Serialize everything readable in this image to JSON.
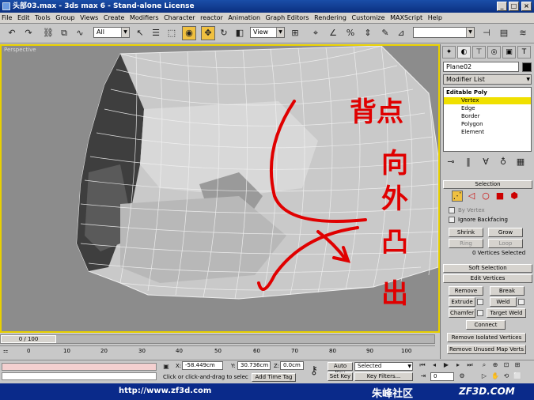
{
  "window": {
    "title": "头部03.max - 3ds max 6 - Stand-alone License"
  },
  "menu": [
    "File",
    "Edit",
    "Tools",
    "Group",
    "Views",
    "Create",
    "Modifiers",
    "Character",
    "reactor",
    "Animation",
    "Graph Editors",
    "Rendering",
    "Customize",
    "MAXScript",
    "Help"
  ],
  "toolbar": {
    "selection_filter": "All",
    "ref_coord": "View"
  },
  "viewport": {
    "label": "Perspective"
  },
  "annotation": {
    "label": "背点",
    "text": "向外凸出"
  },
  "panel": {
    "object_name": "Plane02",
    "object_color": "#000000",
    "modifier_list_label": "Modifier List",
    "stack": [
      {
        "label": "Editable Poly",
        "level": 0
      },
      {
        "label": "Vertex",
        "level": 1
      },
      {
        "label": "Edge",
        "level": 1
      },
      {
        "label": "Border",
        "level": 1
      },
      {
        "label": "Polygon",
        "level": 1
      },
      {
        "label": "Element",
        "level": 1
      }
    ],
    "selection": {
      "rollout_title": "Selection",
      "by_vertex": "By Vertex",
      "ignore_backfacing": "Ignore Backfacing",
      "shrink": "Shrink",
      "grow": "Grow",
      "ring": "Ring",
      "loop": "Loop",
      "status": "0 Vertices Selected"
    },
    "soft_selection": "Soft Selection",
    "edit_vertices": {
      "rollout_title": "Edit Vertices",
      "remove": "Remove",
      "break": "Break",
      "extrude": "Extrude",
      "weld": "Weld",
      "chamfer": "Chamfer",
      "target_weld": "Target Weld",
      "connect": "Connect",
      "remove_isolated": "Remove Isolated Vertices",
      "remove_unused": "Remove Unused Map Verts"
    }
  },
  "timeline": {
    "frame_display": "0 / 100",
    "ticks": [
      "0",
      "10",
      "20",
      "30",
      "40",
      "50",
      "60",
      "70",
      "80",
      "90",
      "100"
    ]
  },
  "status": {
    "x_label": "X:",
    "x_value": "-58.449cm",
    "y_label": "Y:",
    "y_value": "30.736cm",
    "z_label": "Z:",
    "z_value": "0.0cm",
    "prompt": "Click or click-and-drag to select ob",
    "add_time_tag": "Add Time Tag",
    "auto_key": "Auto Key",
    "set_key": "Set Key",
    "key_mode": "Selected",
    "key_filters": "Key Filters...",
    "frame": "0"
  },
  "watermark": {
    "url": "http://www.zf3d.com",
    "brand_cn": "朱峰社区",
    "brand_en": "ZF3D.COM"
  }
}
